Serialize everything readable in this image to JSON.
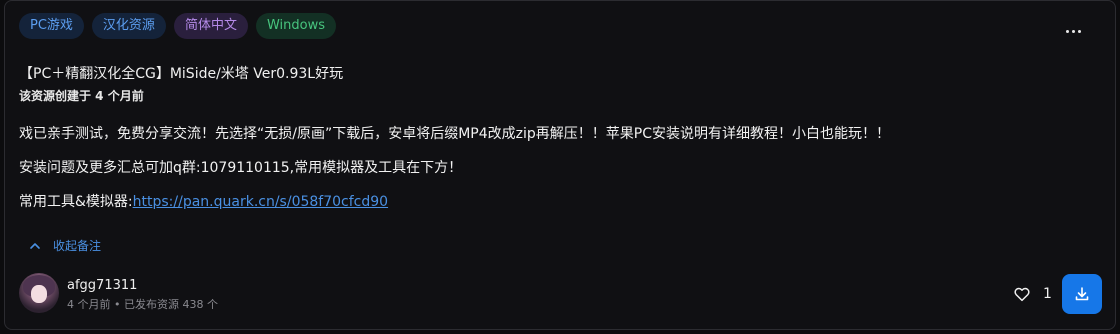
{
  "tags": [
    {
      "label": "PC游戏",
      "color": "#5c9ef0"
    },
    {
      "label": "汉化资源",
      "color": "#5c9ef0"
    },
    {
      "label": "简体中文",
      "color": "#b48ae8"
    },
    {
      "label": "Windows",
      "color": "#47c47e"
    }
  ],
  "post": {
    "title": "【PC＋精翻汉化全CG】MiSide/米塔 Ver0.93L好玩",
    "created": "该资源创建于 4 个月前",
    "paragraphs": [
      "戏已亲手测试，免费分享交流！先选择“无损/原画”下载后，安卓将后缀MP4改成zip再解压！！苹果PC安装说明有详细教程！小白也能玩！！",
      "安装问题及更多汇总可加q群:1079110115,常用模拟器及工具在下方！"
    ],
    "tools_label": "常用工具&模拟器:",
    "tools_link": "https://pan.quark.cn/s/058f70cfcd90",
    "collapse_label": "收起备注"
  },
  "author": {
    "name": "afgg71311",
    "meta": "4 个月前 • 已发布资源 438 个"
  },
  "actions": {
    "like_count": "1"
  },
  "icons": {
    "more": "more-dots-icon",
    "collapse": "chevron-up-icon",
    "like": "heart-icon",
    "download": "download-icon"
  },
  "colors": {
    "accent": "#1677e8",
    "link": "#4a90e2"
  }
}
